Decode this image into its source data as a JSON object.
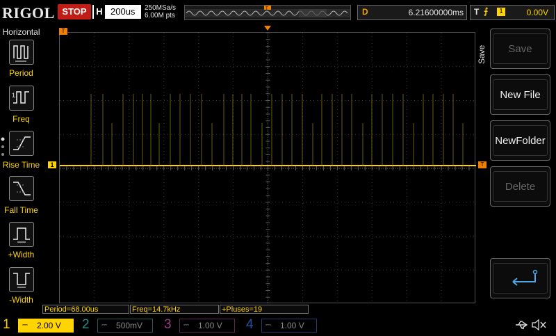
{
  "header": {
    "logo": "RIGOL",
    "run_state": "STOP",
    "horizontal": {
      "key": "H",
      "value": "200us"
    },
    "sample_rate": "250MSa/s",
    "memory_depth": "6.00M pts",
    "delay": {
      "key": "D",
      "value": "6.21600000ms"
    },
    "trigger": {
      "key": "T",
      "icon": "rising-edge-icon",
      "channel": "1",
      "level": "0.00V"
    }
  },
  "left_menu": {
    "title": "Horizontal",
    "items": [
      {
        "label": "Period",
        "icon": "period-icon"
      },
      {
        "label": "Freq",
        "icon": "frequency-icon"
      },
      {
        "label": "Rise Time",
        "icon": "rise-time-icon"
      },
      {
        "label": "Fall Time",
        "icon": "fall-time-icon"
      },
      {
        "label": "+Width",
        "icon": "positive-width-icon"
      },
      {
        "label": "-Width",
        "icon": "negative-width-icon"
      }
    ]
  },
  "right_menu": {
    "title": "Save",
    "buttons": [
      {
        "label": "Save",
        "enabled": false
      },
      {
        "label": "New File",
        "enabled": true
      },
      {
        "label": "NewFolder",
        "enabled": true
      },
      {
        "label": "Delete",
        "enabled": false
      },
      {
        "label": "",
        "icon": "enter-return-icon",
        "enabled": true
      }
    ]
  },
  "markers": {
    "trigger_position": "T",
    "channel1_offset": "1",
    "trigger_level": "T"
  },
  "measurements": [
    {
      "text": "Period=68.00us"
    },
    {
      "text": "Freq=14.7kHz"
    },
    {
      "text": "+Pluses=19"
    }
  ],
  "channels": [
    {
      "num": "1",
      "scale": "2.00 V",
      "color": "#ffd400",
      "active": true
    },
    {
      "num": "2",
      "scale": "500mV",
      "color": "#2a8a8a",
      "active": false
    },
    {
      "num": "3",
      "scale": "1.00 V",
      "color": "#a03a8a",
      "active": false
    },
    {
      "num": "4",
      "scale": "1.00 V",
      "color": "#2a4f9a",
      "active": false
    }
  ],
  "status_icons": [
    "usb-icon",
    "speaker-muted-icon"
  ],
  "colors": {
    "ch1": "#ffd400",
    "stop": "#c01d17",
    "delay_key": "#f0a000"
  }
}
